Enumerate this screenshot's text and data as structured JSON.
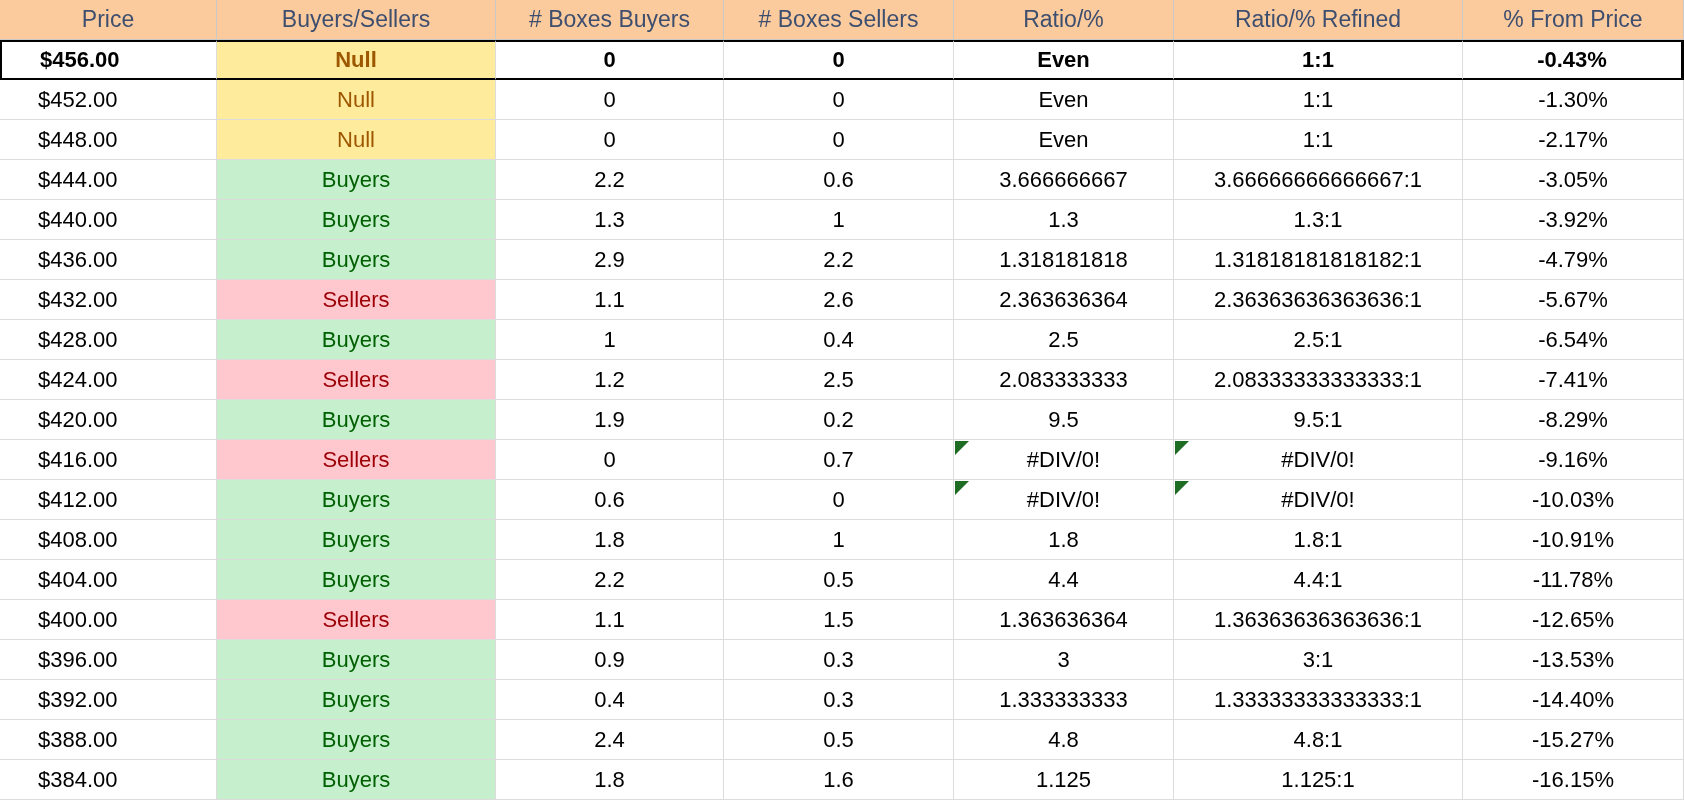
{
  "table": {
    "columns": [
      "Price",
      "Buyers/Sellers",
      "# Boxes Buyers",
      "# Boxes Sellers",
      "Ratio/%",
      "Ratio/% Refined",
      "% From Price"
    ],
    "rows": [
      {
        "price": "$456.00",
        "side": "Null",
        "kind": "null",
        "buyers": "0",
        "sellers": "0",
        "ratio": "Even",
        "refined": "1:1",
        "from_price": "-0.43%",
        "flagged": false,
        "selected": true
      },
      {
        "price": "$452.00",
        "side": "Null",
        "kind": "null",
        "buyers": "0",
        "sellers": "0",
        "ratio": "Even",
        "refined": "1:1",
        "from_price": "-1.30%",
        "flagged": false,
        "selected": false
      },
      {
        "price": "$448.00",
        "side": "Null",
        "kind": "null",
        "buyers": "0",
        "sellers": "0",
        "ratio": "Even",
        "refined": "1:1",
        "from_price": "-2.17%",
        "flagged": false,
        "selected": false
      },
      {
        "price": "$444.00",
        "side": "Buyers",
        "kind": "buyers",
        "buyers": "2.2",
        "sellers": "0.6",
        "ratio": "3.666666667",
        "refined": "3.66666666666667:1",
        "from_price": "-3.05%",
        "flagged": false,
        "selected": false
      },
      {
        "price": "$440.00",
        "side": "Buyers",
        "kind": "buyers",
        "buyers": "1.3",
        "sellers": "1",
        "ratio": "1.3",
        "refined": "1.3:1",
        "from_price": "-3.92%",
        "flagged": false,
        "selected": false
      },
      {
        "price": "$436.00",
        "side": "Buyers",
        "kind": "buyers",
        "buyers": "2.9",
        "sellers": "2.2",
        "ratio": "1.318181818",
        "refined": "1.31818181818182:1",
        "from_price": "-4.79%",
        "flagged": false,
        "selected": false
      },
      {
        "price": "$432.00",
        "side": "Sellers",
        "kind": "sellers",
        "buyers": "1.1",
        "sellers": "2.6",
        "ratio": "2.363636364",
        "refined": "2.36363636363636:1",
        "from_price": "-5.67%",
        "flagged": false,
        "selected": false
      },
      {
        "price": "$428.00",
        "side": "Buyers",
        "kind": "buyers",
        "buyers": "1",
        "sellers": "0.4",
        "ratio": "2.5",
        "refined": "2.5:1",
        "from_price": "-6.54%",
        "flagged": false,
        "selected": false
      },
      {
        "price": "$424.00",
        "side": "Sellers",
        "kind": "sellers",
        "buyers": "1.2",
        "sellers": "2.5",
        "ratio": "2.083333333",
        "refined": "2.08333333333333:1",
        "from_price": "-7.41%",
        "flagged": false,
        "selected": false
      },
      {
        "price": "$420.00",
        "side": "Buyers",
        "kind": "buyers",
        "buyers": "1.9",
        "sellers": "0.2",
        "ratio": "9.5",
        "refined": "9.5:1",
        "from_price": "-8.29%",
        "flagged": false,
        "selected": false
      },
      {
        "price": "$416.00",
        "side": "Sellers",
        "kind": "sellers",
        "buyers": "0",
        "sellers": "0.7",
        "ratio": "#DIV/0!",
        "refined": "#DIV/0!",
        "from_price": "-9.16%",
        "flagged": true,
        "selected": false
      },
      {
        "price": "$412.00",
        "side": "Buyers",
        "kind": "buyers",
        "buyers": "0.6",
        "sellers": "0",
        "ratio": "#DIV/0!",
        "refined": "#DIV/0!",
        "from_price": "-10.03%",
        "flagged": true,
        "selected": false
      },
      {
        "price": "$408.00",
        "side": "Buyers",
        "kind": "buyers",
        "buyers": "1.8",
        "sellers": "1",
        "ratio": "1.8",
        "refined": "1.8:1",
        "from_price": "-10.91%",
        "flagged": false,
        "selected": false
      },
      {
        "price": "$404.00",
        "side": "Buyers",
        "kind": "buyers",
        "buyers": "2.2",
        "sellers": "0.5",
        "ratio": "4.4",
        "refined": "4.4:1",
        "from_price": "-11.78%",
        "flagged": false,
        "selected": false
      },
      {
        "price": "$400.00",
        "side": "Sellers",
        "kind": "sellers",
        "buyers": "1.1",
        "sellers": "1.5",
        "ratio": "1.363636364",
        "refined": "1.36363636363636:1",
        "from_price": "-12.65%",
        "flagged": false,
        "selected": false
      },
      {
        "price": "$396.00",
        "side": "Buyers",
        "kind": "buyers",
        "buyers": "0.9",
        "sellers": "0.3",
        "ratio": "3",
        "refined": "3:1",
        "from_price": "-13.53%",
        "flagged": false,
        "selected": false
      },
      {
        "price": "$392.00",
        "side": "Buyers",
        "kind": "buyers",
        "buyers": "0.4",
        "sellers": "0.3",
        "ratio": "1.333333333",
        "refined": "1.33333333333333:1",
        "from_price": "-14.40%",
        "flagged": false,
        "selected": false
      },
      {
        "price": "$388.00",
        "side": "Buyers",
        "kind": "buyers",
        "buyers": "2.4",
        "sellers": "0.5",
        "ratio": "4.8",
        "refined": "4.8:1",
        "from_price": "-15.27%",
        "flagged": false,
        "selected": false
      },
      {
        "price": "$384.00",
        "side": "Buyers",
        "kind": "buyers",
        "buyers": "1.8",
        "sellers": "1.6",
        "ratio": "1.125",
        "refined": "1.125:1",
        "from_price": "-16.15%",
        "flagged": false,
        "selected": false
      }
    ]
  }
}
